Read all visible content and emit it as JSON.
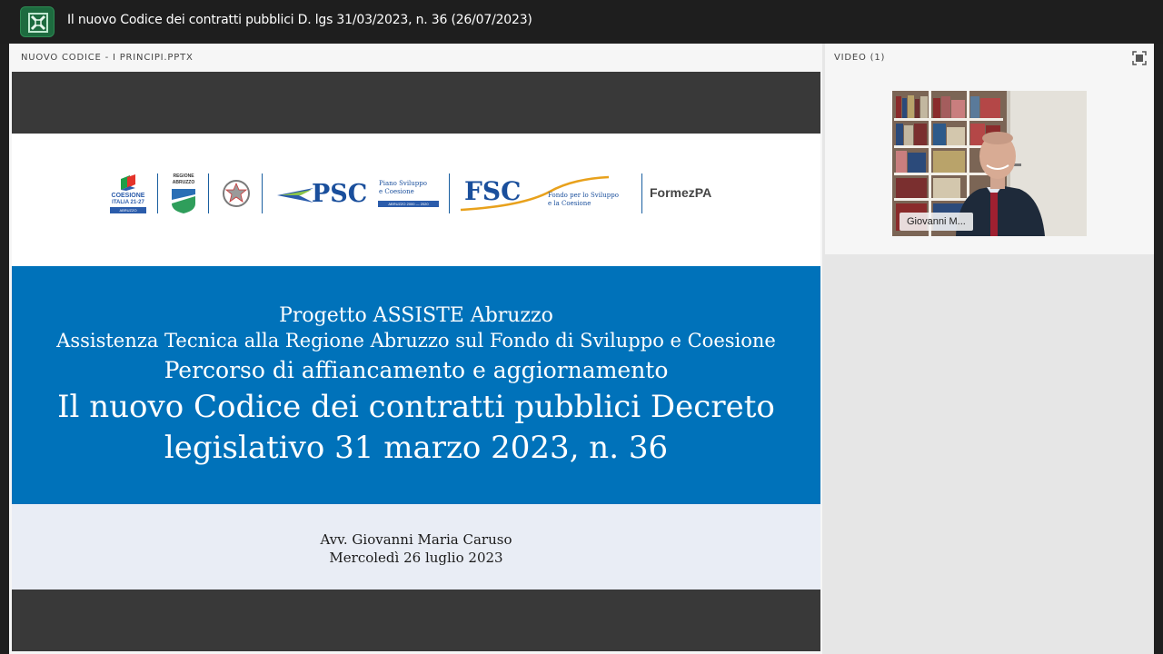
{
  "window": {
    "title": "Il nuovo Codice dei contratti pubblici D. lgs 31/03/2023, n. 36 (26/07/2023)"
  },
  "share_pod": {
    "title": "NUOVO CODICE - I PRINCIPI.PPTX"
  },
  "slide": {
    "logos": {
      "coesione_1": "COESIONE",
      "coesione_2": "ITALIA 21-27",
      "coesione_3": "ABRUZZO",
      "regione_1": "REGIONE",
      "regione_2": "ABRUZZO",
      "psc": "PSC",
      "psc_sub_1": "Piano Sviluppo",
      "psc_sub_2": "e Coesione",
      "psc_badge": "ABRUZZO 2000 — 2020",
      "fsc": "FSC",
      "fsc_sub_1": "Fondo per lo Sviluppo",
      "fsc_sub_2": "e la Coesione",
      "formez": "FormezPA"
    },
    "line1": "Progetto ASSISTE Abruzzo",
    "line2": "Assistenza Tecnica alla Regione Abruzzo sul Fondo di Sviluppo e Coesione",
    "line3": "Percorso di affiancamento e aggiornamento",
    "line4": "Il nuovo Codice dei contratti pubblici Decreto",
    "line5": "legislativo 31 marzo 2023, n. 36",
    "author": "Avv. Giovanni Maria Caruso",
    "date": "Mercoledì 26 luglio 2023"
  },
  "video_pod": {
    "title": "VIDEO (1)",
    "participant_name": "Giovanni M...",
    "fullscreen_icon": "fullscreen-icon"
  },
  "colors": {
    "slide_blue": "#0072ba",
    "slide_dark_band": "#393939",
    "slide_light_band": "#e9edf5",
    "app_logo_green": "#1d6b3f"
  }
}
